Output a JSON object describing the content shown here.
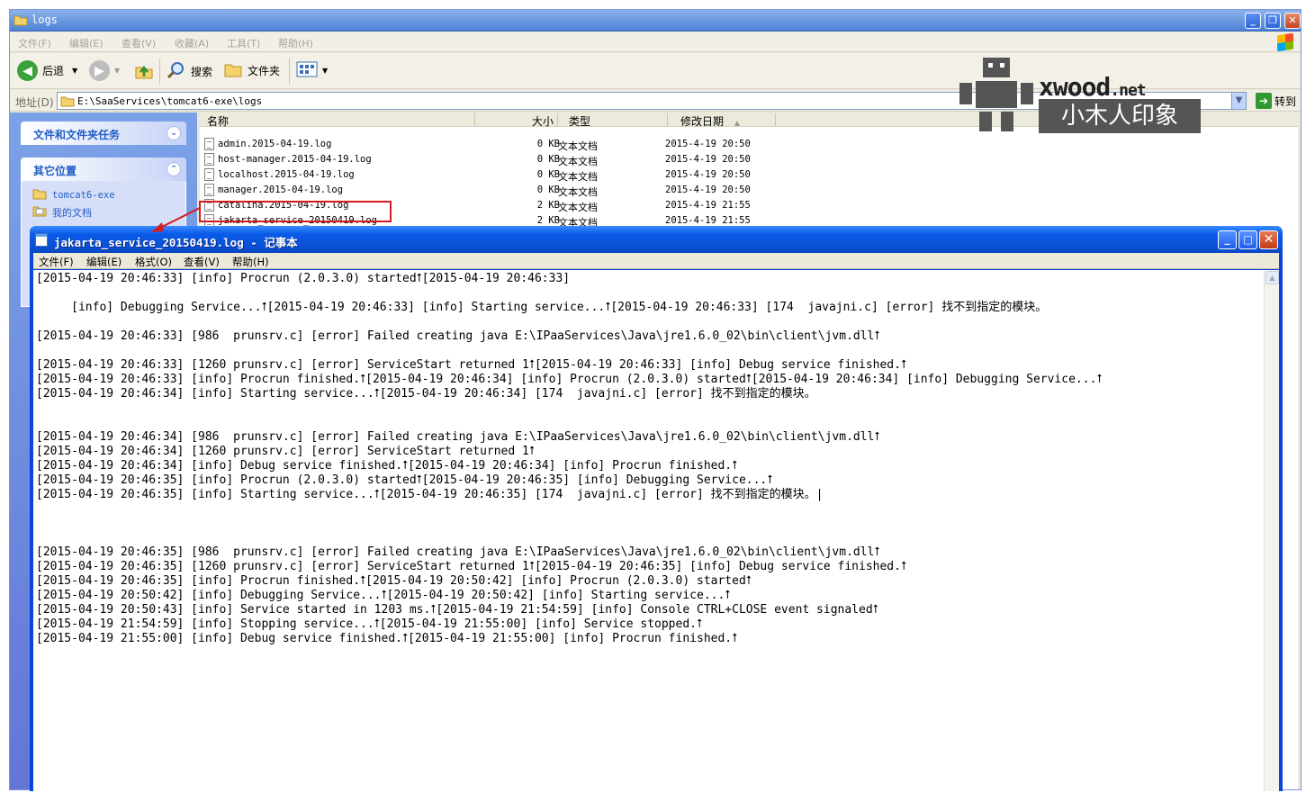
{
  "explorer": {
    "title": "logs",
    "menu": [
      "文件(F)",
      "编辑(E)",
      "查看(V)",
      "收藏(A)",
      "工具(T)",
      "帮助(H)"
    ],
    "toolbar": {
      "back": "后退",
      "search": "搜索",
      "folders": "文件夹"
    },
    "address_label": "地址(D)",
    "address": "E:\\SaaServices\\tomcat6-exe\\logs",
    "go": "转到",
    "tasks_title": "文件和文件夹任务",
    "other_places_title": "其它位置",
    "other_places": [
      "tomcat6-exe",
      "我的文档"
    ],
    "columns": {
      "name": "名称",
      "size": "大小",
      "type": "类型",
      "modified": "修改日期"
    },
    "files": [
      {
        "name": "admin.2015-04-19.log",
        "size": "0 KB",
        "type": "文本文档",
        "modified": "2015-4-19 20:50"
      },
      {
        "name": "host-manager.2015-04-19.log",
        "size": "0 KB",
        "type": "文本文档",
        "modified": "2015-4-19 20:50"
      },
      {
        "name": "localhost.2015-04-19.log",
        "size": "0 KB",
        "type": "文本文档",
        "modified": "2015-4-19 20:50"
      },
      {
        "name": "manager.2015-04-19.log",
        "size": "0 KB",
        "type": "文本文档",
        "modified": "2015-4-19 20:50"
      },
      {
        "name": "catalina.2015-04-19.log",
        "size": "2 KB",
        "type": "文本文档",
        "modified": "2015-4-19 21:55"
      },
      {
        "name": "jakarta_service_20150419.log",
        "size": "2 KB",
        "type": "文本文档",
        "modified": "2015-4-19 21:55"
      }
    ]
  },
  "watermark": {
    "brand": "xwood",
    "brand_suffix": ".net",
    "tagline": "小木人印象"
  },
  "notepad": {
    "title": "jakarta_service_20150419.log - 记事本",
    "menu": [
      "文件(F)",
      "编辑(E)",
      "格式(O)",
      "查看(V)",
      "帮助(H)"
    ],
    "content": "[2015-04-19 20:46:33] [info] Procrun (2.0.3.0) started⭡[2015-04-19 20:46:33]\n\n     [info] Debugging Service...⭡[2015-04-19 20:46:33] [info] Starting service...⭡[2015-04-19 20:46:33] [174  javajni.c] [error] 找不到指定的模块。\n\n[2015-04-19 20:46:33] [986  prunsrv.c] [error] Failed creating java E:\\IPaaServices\\Java\\jre1.6.0_02\\bin\\client\\jvm.dll⭡\n\n[2015-04-19 20:46:33] [1260 prunsrv.c] [error] ServiceStart returned 1⭡[2015-04-19 20:46:33] [info] Debug service finished.⭡\n[2015-04-19 20:46:33] [info] Procrun finished.⭡[2015-04-19 20:46:34] [info] Procrun (2.0.3.0) started⭡[2015-04-19 20:46:34] [info] Debugging Service...⭡\n[2015-04-19 20:46:34] [info] Starting service...⭡[2015-04-19 20:46:34] [174  javajni.c] [error] 找不到指定的模块。\n\n\n[2015-04-19 20:46:34] [986  prunsrv.c] [error] Failed creating java E:\\IPaaServices\\Java\\jre1.6.0_02\\bin\\client\\jvm.dll⭡\n[2015-04-19 20:46:34] [1260 prunsrv.c] [error] ServiceStart returned 1⭡\n[2015-04-19 20:46:34] [info] Debug service finished.⭡[2015-04-19 20:46:34] [info] Procrun finished.⭡\n[2015-04-19 20:46:35] [info] Procrun (2.0.3.0) started⭡[2015-04-19 20:46:35] [info] Debugging Service...⭡\n[2015-04-19 20:46:35] [info] Starting service...⭡[2015-04-19 20:46:35] [174  javajni.c] [error] 找不到指定的模块。|\n\n\n\n[2015-04-19 20:46:35] [986  prunsrv.c] [error] Failed creating java E:\\IPaaServices\\Java\\jre1.6.0_02\\bin\\client\\jvm.dll⭡\n[2015-04-19 20:46:35] [1260 prunsrv.c] [error] ServiceStart returned 1⭡[2015-04-19 20:46:35] [info] Debug service finished.⭡\n[2015-04-19 20:46:35] [info] Procrun finished.⭡[2015-04-19 20:50:42] [info] Procrun (2.0.3.0) started⭡\n[2015-04-19 20:50:42] [info] Debugging Service...⭡[2015-04-19 20:50:42] [info] Starting service...⭡\n[2015-04-19 20:50:43] [info] Service started in 1203 ms.⭡[2015-04-19 21:54:59] [info] Console CTRL+CLOSE event signaled⭡\n[2015-04-19 21:54:59] [info] Stopping service...⭡[2015-04-19 21:55:00] [info] Service stopped.⭡\n[2015-04-19 21:55:00] [info] Debug service finished.⭡[2015-04-19 21:55:00] [info] Procrun finished.⭡"
  }
}
